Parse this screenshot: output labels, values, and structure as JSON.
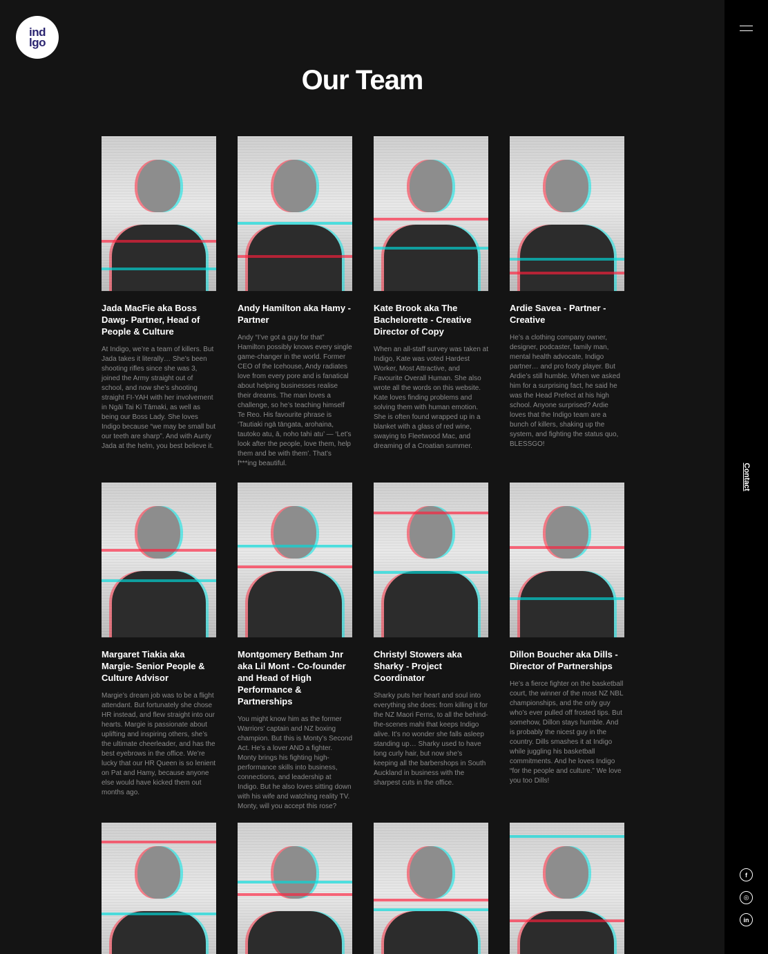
{
  "logo": {
    "line1": "ind",
    "line2": "lgo"
  },
  "page_title": "Our Team",
  "nav": {
    "contact_label": "Contact",
    "menu_icon": "hamburger-icon"
  },
  "social": [
    {
      "icon": "facebook-icon",
      "glyph": "f"
    },
    {
      "icon": "instagram-icon",
      "glyph": "◎"
    },
    {
      "icon": "linkedin-icon",
      "glyph": "in"
    }
  ],
  "team": [
    {
      "name": "Jada MacFie aka Boss Dawg- Partner, Head of People & Culture",
      "bio": "At Indigo, we’re a team of killers. But Jada takes it literally… She’s been shooting rifles since she was 3, joined the Army straight out of school, and now she’s shooting straight FI-YAH with her involvement in Ngāi Tai Ki Tāmaki, as well as being our Boss Lady. She loves Indigo because “we may be small but our teeth are sharp”. And with Aunty Jada at the helm, you best believe it."
    },
    {
      "name": "Andy Hamilton aka Hamy - Partner",
      "bio": "Andy “I’ve got a guy for that” Hamilton possibly knows every single game-changer in the world. Former CEO of the Icehouse, Andy radiates love from every pore and is fanatical about helping businesses realise their dreams. The man loves a challenge, so he’s teaching himself Te Reo. His favourite phrase is ‘Tautiaki ngā tāngata, arohaina, tautoko atu, ā, noho tahi atu’ — ‘Let’s look after the people, love them, help them and be with them’. That’s f***ing beautiful."
    },
    {
      "name": "Kate Brook aka The Bachelorette - Creative Director of Copy",
      "bio": "When an all-staff survey was taken at Indigo, Kate was voted Hardest Worker, Most Attractive, and Favourite Overall Human. She also wrote all the words on this website. Kate loves finding problems and solving them with human emotion. She is often found wrapped up in a blanket with a glass of red wine, swaying to Fleetwood Mac, and dreaming of a Croatian summer."
    },
    {
      "name": "Ardie Savea - Partner - Creative",
      "bio": "He’s a clothing company owner, designer, podcaster, family man, mental health advocate, Indigo partner… and pro footy player. But Ardie’s still humble. When we asked him for a surprising fact, he said he was the Head Prefect at his high school. Anyone surprised? Ardie loves that the Indigo team are a bunch of killers, shaking up the system, and fighting the status quo, BLESSGO!"
    },
    {
      "name": "Margaret Tiakia aka Margie- Senior People & Culture Advisor",
      "bio": "Margie’s dream job was to be a flight attendant. But fortunately she chose HR instead, and flew straight into our hearts. Margie is passionate about uplifting and inspiring others, she’s the ultimate cheerleader, and has the best eyebrows in the office. We’re lucky that our HR Queen is so lenient on Pat and Hamy, because anyone else would have kicked them out months ago."
    },
    {
      "name": "Montgomery Betham Jnr aka Lil Mont - Co-founder and Head of High Performance & Partnerships",
      "bio": "You might know him as the former Warriors’ captain and NZ boxing champion. But this is Monty’s Second Act. He’s a lover AND a fighter. Monty brings his fighting high-performance skills into business, connections, and leadership at Indigo. But he also loves sitting down with his wife and watching reality TV. Monty, will you accept this rose?"
    },
    {
      "name": "Christyl Stowers aka Sharky - Project Coordinator",
      "bio": "Sharky puts her heart and soul into everything she does: from killing it for the NZ Maori Ferns, to all the behind-the-scenes mahi that keeps Indigo alive. It’s no wonder she falls asleep standing up… Sharky used to have long curly hair, but now she’s keeping all the barbershops in South Auckland in business with the sharpest cuts in the office."
    },
    {
      "name": "Dillon Boucher aka Dills - Director of Partnerships",
      "bio": "He’s a fierce fighter on the basketball court, the winner of the most NZ NBL championships, and the only guy who’s ever pulled off frosted tips. But somehow, Dillon stays humble. And is probably the nicest guy in the country. Dills smashes it at Indigo while juggling his basketball commitments. And he loves Indigo “for the people and culture.” We love you too Dills!"
    },
    {
      "name": "",
      "bio": ""
    },
    {
      "name": "",
      "bio": ""
    },
    {
      "name": "",
      "bio": ""
    },
    {
      "name": "",
      "bio": ""
    }
  ]
}
